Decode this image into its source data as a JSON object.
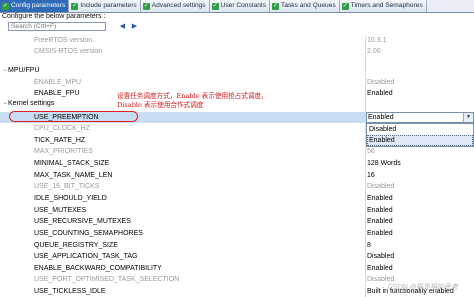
{
  "tabs": [
    {
      "label": "Config parameters",
      "checked": true,
      "active": true
    },
    {
      "label": "Include parameters",
      "checked": true,
      "active": false
    },
    {
      "label": "Advanced settings",
      "checked": true,
      "active": false
    },
    {
      "label": "User Constants",
      "checked": true,
      "active": false
    },
    {
      "label": "Tasks and Queues",
      "checked": true,
      "active": false
    },
    {
      "label": "Timers and Semaphores",
      "checked": true,
      "active": false
    }
  ],
  "subtitle": "Configure the below parameters :",
  "search": {
    "placeholder": "Search (Crtl+F)"
  },
  "nav": {
    "prev": "◀",
    "next": "▶"
  },
  "rows_top": [
    {
      "name": "FreeRTOS version",
      "value": "10.3.1",
      "gray": true
    },
    {
      "name": "CMSIS-RTOS version",
      "value": "2.00",
      "gray": true
    }
  ],
  "section_mpu": "MPU/FPU",
  "rows_mpu": [
    {
      "name": "ENABLE_MPU",
      "value": "Disabled",
      "gray": true
    },
    {
      "name": "ENABLE_FPU",
      "value": "Enabled",
      "gray": false
    }
  ],
  "section_kernel": "Kernel settings",
  "kernel_first": {
    "name": "USE_PREEMPTION",
    "value": "Enabled"
  },
  "rows_kernel": [
    {
      "name": "CPU_CLOCK_HZ",
      "value": "",
      "gray": true
    },
    {
      "name": "TICK_RATE_HZ",
      "value": "",
      "gray": false
    },
    {
      "name": "MAX_PRIORITIES",
      "value": "56",
      "gray": true
    },
    {
      "name": "MINIMAL_STACK_SIZE",
      "value": "128 Words",
      "gray": false
    },
    {
      "name": "MAX_TASK_NAME_LEN",
      "value": "16",
      "gray": false
    },
    {
      "name": "USE_16_BIT_TICKS",
      "value": "Disabled",
      "gray": true
    },
    {
      "name": "IDLE_SHOULD_YIELD",
      "value": "Enabled",
      "gray": false
    },
    {
      "name": "USE_MUTEXES",
      "value": "Enabled",
      "gray": false
    },
    {
      "name": "USE_RECURSIVE_MUTEXES",
      "value": "Enabled",
      "gray": false
    },
    {
      "name": "USE_COUNTING_SEMAPHORES",
      "value": "Enabled",
      "gray": false
    },
    {
      "name": "QUEUE_REGISTRY_SIZE",
      "value": "8",
      "gray": false
    },
    {
      "name": "USE_APPLICATION_TASK_TAG",
      "value": "Disabled",
      "gray": false
    },
    {
      "name": "ENABLE_BACKWARD_COMPATIBILITY",
      "value": "Enabled",
      "gray": false
    },
    {
      "name": "USE_PORT_OPTIMISED_TASK_SELECTION",
      "value": "Disabled",
      "gray": true
    },
    {
      "name": "USE_TICKLESS_IDLE",
      "value": "Built in functionality enabled",
      "gray": false
    }
  ],
  "dropdown": {
    "options": [
      "Disabled",
      "Enabled"
    ]
  },
  "annotation": {
    "line1": "设置任务调度方式，Enable 表示使用抢占式调度，",
    "line2": "Disable 表示使用合作式调度"
  },
  "watermark": "CSDN @猫是猫的思考"
}
